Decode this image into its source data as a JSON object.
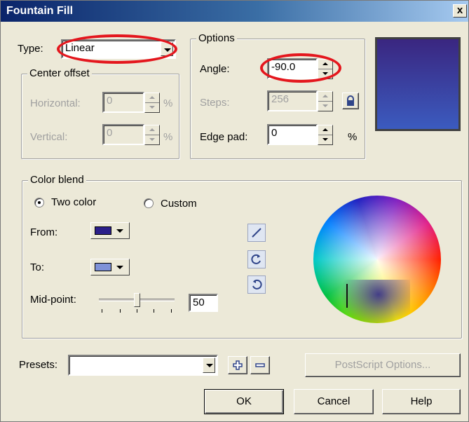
{
  "window": {
    "title": "Fountain Fill",
    "close_glyph": "x"
  },
  "type": {
    "label": "Type:",
    "value": "Linear"
  },
  "center_offset": {
    "title": "Center offset",
    "horizontal_label": "Horizontal:",
    "horizontal_value": "0",
    "horizontal_unit": "%",
    "vertical_label": "Vertical:",
    "vertical_value": "0",
    "vertical_unit": "%"
  },
  "options": {
    "title": "Options",
    "angle_label": "Angle:",
    "angle_value": "-90.0",
    "steps_label": "Steps:",
    "steps_value": "256",
    "edge_pad_label": "Edge pad:",
    "edge_pad_value": "0",
    "edge_pad_unit": "%"
  },
  "preview": {
    "color_top": "#3a2680",
    "color_bottom": "#3b5bbf"
  },
  "color_blend": {
    "title": "Color blend",
    "two_color_label": "Two color",
    "custom_label": "Custom",
    "selected": "two_color",
    "from_label": "From:",
    "from_color": "#2b1f8a",
    "to_label": "To:",
    "to_color": "#7f92d8",
    "midpoint_label": "Mid-point:",
    "midpoint_value": "50"
  },
  "presets": {
    "label": "Presets:",
    "value": ""
  },
  "buttons": {
    "postscript": "PostScript Options...",
    "ok": "OK",
    "cancel": "Cancel",
    "help": "Help"
  },
  "colors": {
    "highlight_ellipse": "#e4161d",
    "title_bar": "#0a246a"
  }
}
